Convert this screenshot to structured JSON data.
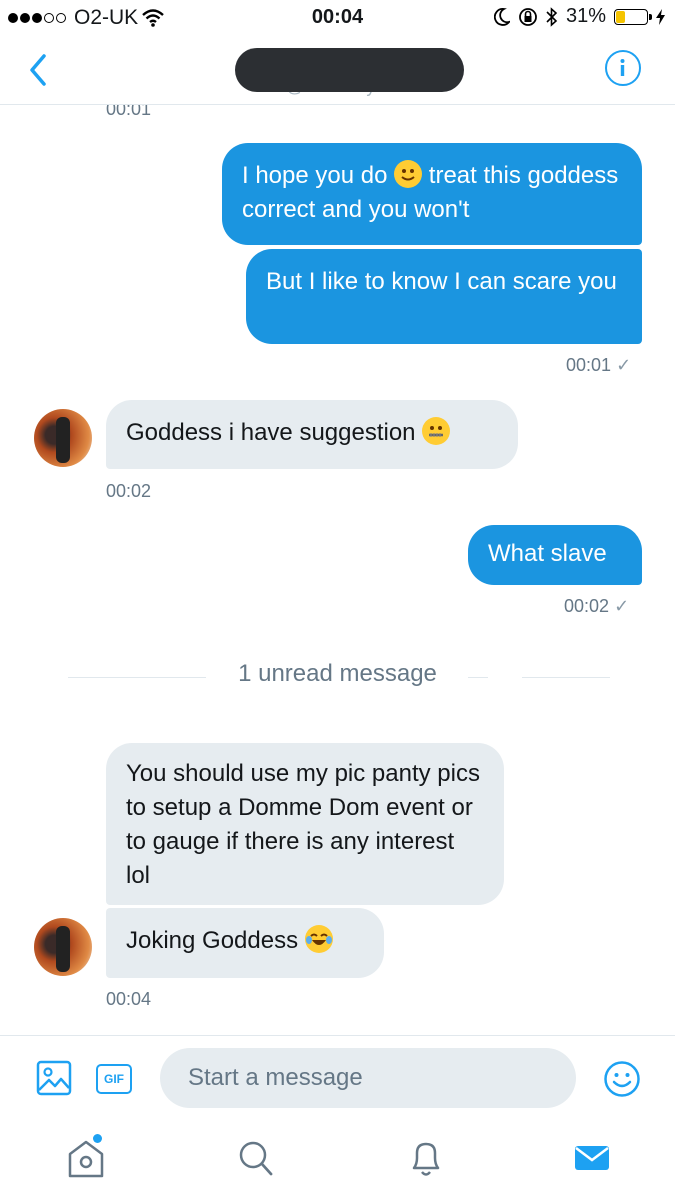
{
  "status_bar": {
    "carrier": "O2-UK",
    "time": "00:04",
    "battery_percent": "31%",
    "battery_level": 0.31
  },
  "header": {
    "handle_partial": "@slaveboy..."
  },
  "messages": [
    {
      "kind": "timestamp",
      "text": "00:01"
    },
    {
      "kind": "outgoing",
      "text_before": "I hope you do",
      "emoji": "slightly-smiling-face",
      "text_after": "treat this goddess correct and you won't"
    },
    {
      "kind": "outgoing",
      "text": "But I like to know I can scare you"
    },
    {
      "kind": "timestamp_out",
      "text": "00:01"
    },
    {
      "kind": "incoming",
      "text": "Goddess i have suggestion",
      "emoji": "zipper-mouth-face"
    },
    {
      "kind": "timestamp_in",
      "text": "00:02"
    },
    {
      "kind": "outgoing",
      "text": "What slave"
    },
    {
      "kind": "timestamp_out",
      "text": "00:02"
    },
    {
      "kind": "incoming",
      "text": "You should use my pic panty pics to setup a Domme Dom event or to gauge if there is any interest lol"
    },
    {
      "kind": "incoming",
      "text": "Joking Goddess",
      "emoji": "tears-of-joy-face"
    },
    {
      "kind": "timestamp_in",
      "text": "00:04"
    }
  ],
  "unread_divider": "1 unread message",
  "check_mark": "✓",
  "composer": {
    "gif_label": "GIF",
    "placeholder": "Start a message"
  },
  "tabs": [
    "home",
    "search",
    "notifications",
    "messages"
  ],
  "colors": {
    "accent": "#1da1f2",
    "outgoing_bubble": "#1b95e0",
    "incoming_bubble": "#e6ecf0"
  }
}
